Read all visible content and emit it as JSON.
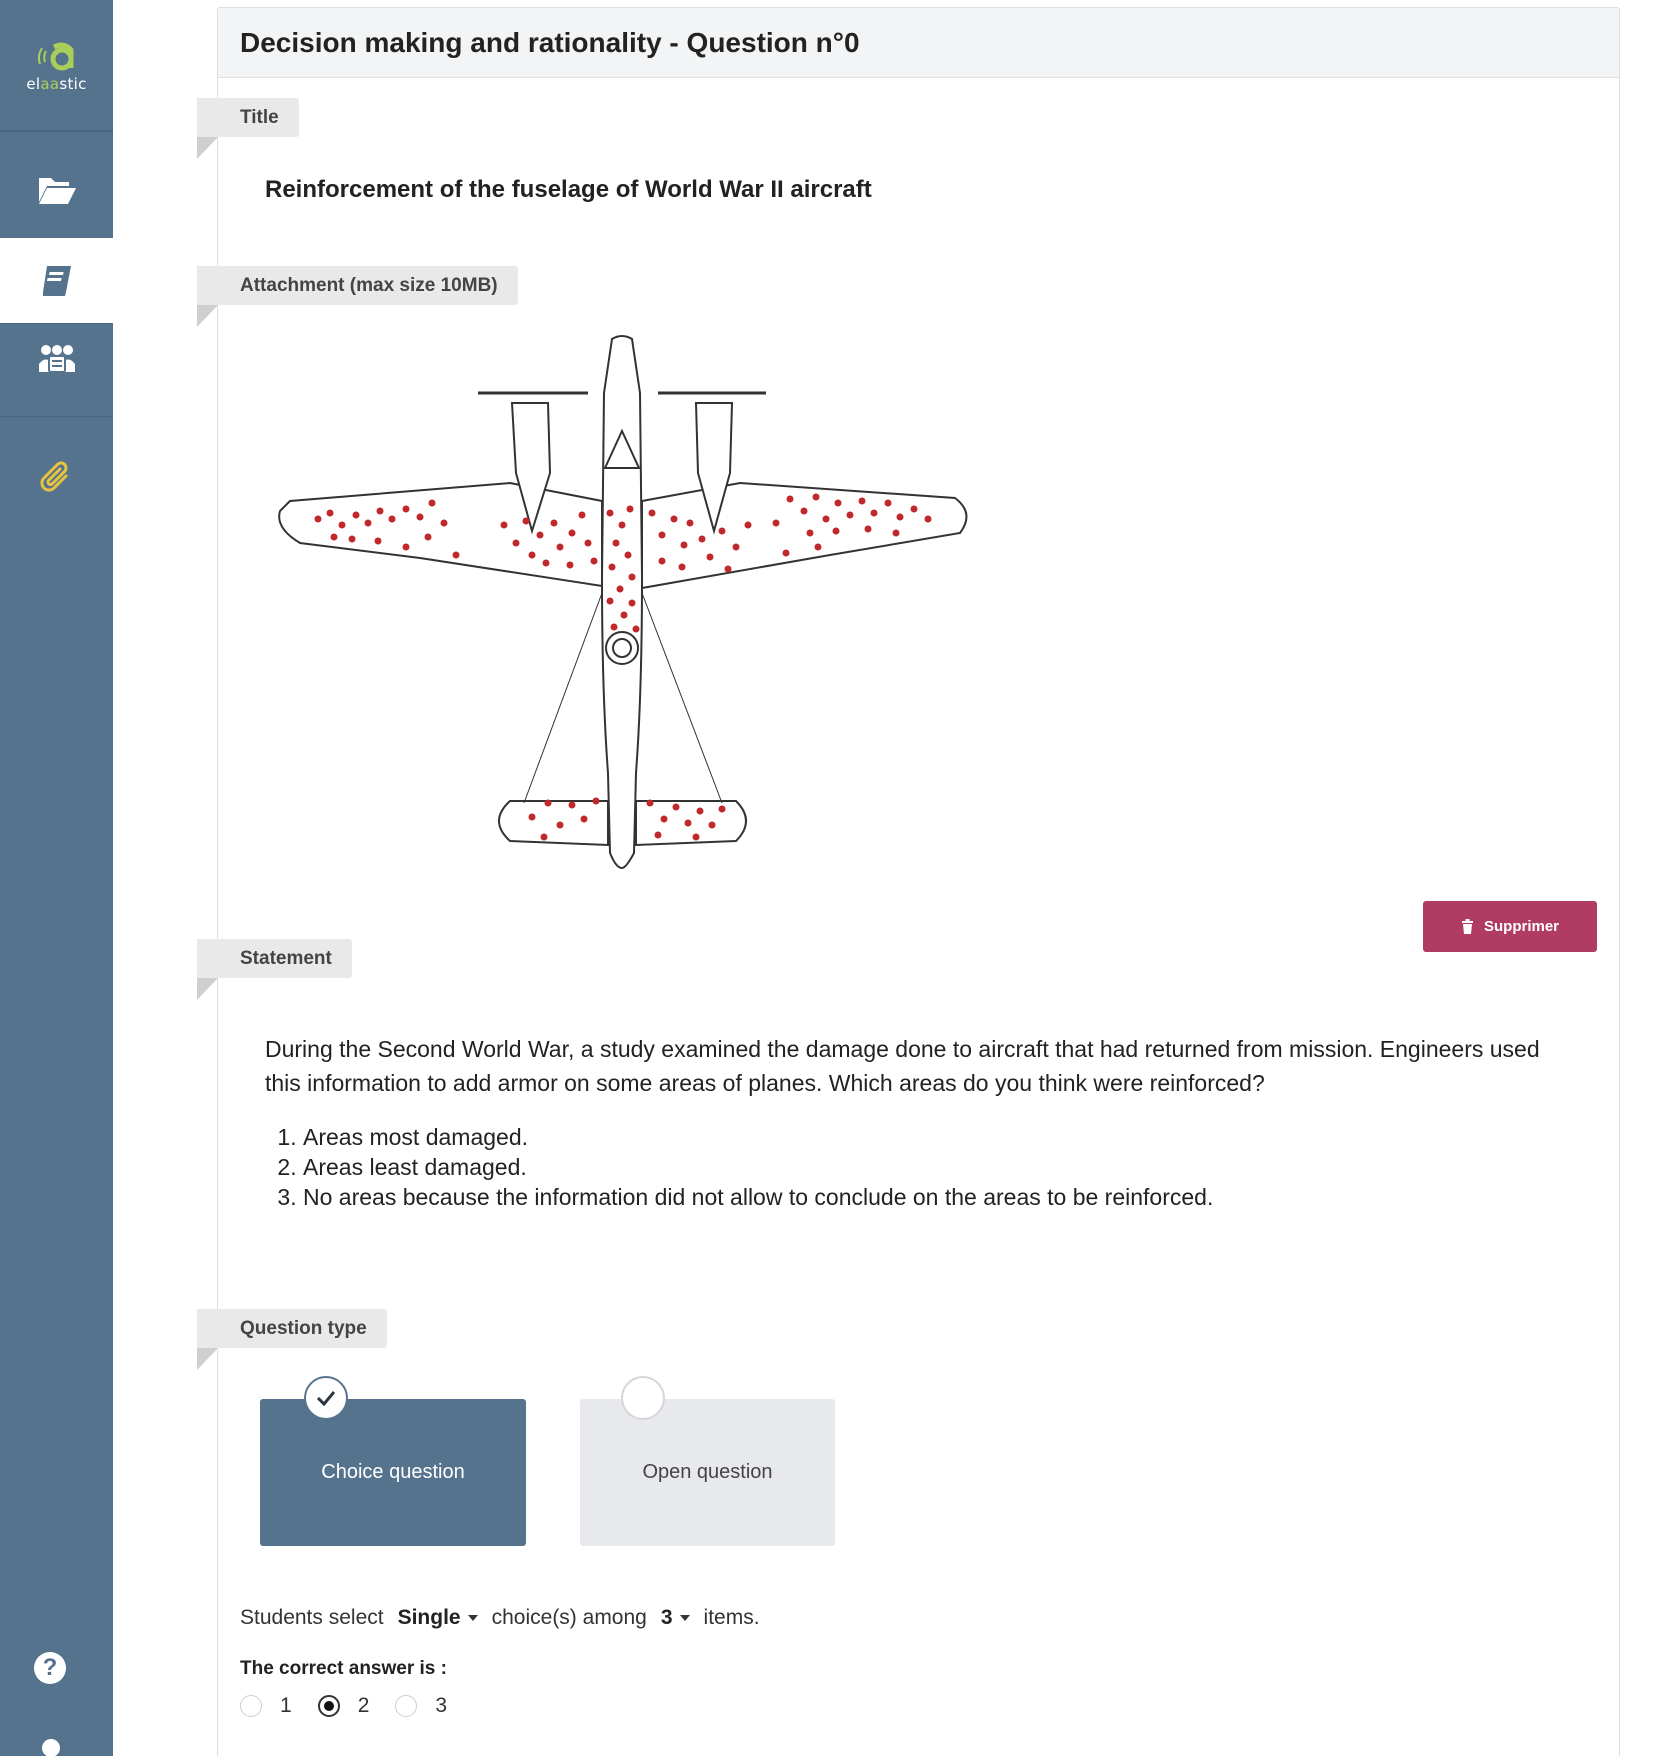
{
  "sidebar": {
    "logo_prefix": "el",
    "logo_accent": "aa",
    "logo_suffix": "stic",
    "items": [
      {
        "icon": "folder-open-icon"
      },
      {
        "icon": "book-icon",
        "active": true
      },
      {
        "icon": "users-icon"
      },
      {
        "icon": "paperclip-icon"
      }
    ],
    "help_glyph": "?"
  },
  "header": {
    "title": "Decision making and rationality - Question n°0"
  },
  "sections": {
    "title_label": "Title",
    "attachment_label": "Attachment (max size 10MB)",
    "statement_label": "Statement",
    "question_type_label": "Question type"
  },
  "question": {
    "title": "Reinforcement of the fuselage of World War II aircraft",
    "statement": "During the Second World War, a study examined the damage done to aircraft that had returned from mission. Engineers used this information to add armor on some areas of planes. Which areas do you think were reinforced?",
    "options": [
      "Areas most damaged.",
      "Areas least damaged.",
      "No areas because the information did not allow to conclude on the areas to be reinforced."
    ]
  },
  "attachment": {
    "delete_label": "Supprimer"
  },
  "question_type": {
    "choice_label": "Choice question",
    "open_label": "Open question",
    "selected": "choice"
  },
  "settings": {
    "prefix": "Students select",
    "mode": "Single",
    "middle": "choice(s) among",
    "count": "3",
    "suffix": "items."
  },
  "correct_answer": {
    "label": "The correct answer is :",
    "choices": [
      "1",
      "2",
      "3"
    ],
    "selected_index": 1
  },
  "colors": {
    "sidebar": "#56738e",
    "danger": "#b03c63",
    "bullet": "#c0282b",
    "logo_accent": "#a9cf5a"
  }
}
